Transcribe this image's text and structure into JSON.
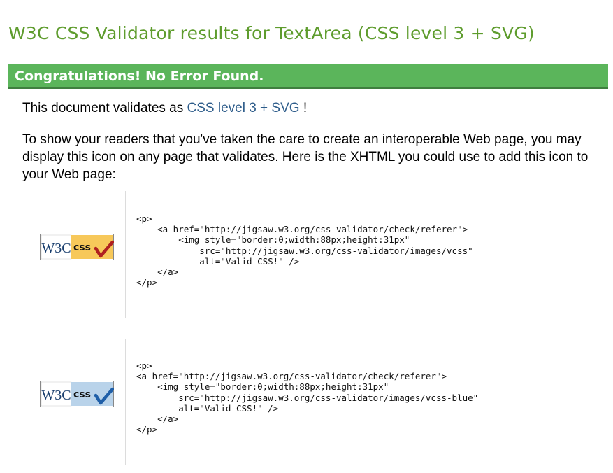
{
  "page": {
    "title": "W3C CSS Validator results for TextArea (CSS level 3 + SVG)"
  },
  "banner": {
    "text": "Congratulations! No Error Found.",
    "color": "#5bb55b"
  },
  "validates": {
    "prefix": "This document validates as ",
    "link_text": "CSS level 3 + SVG",
    "suffix": " !"
  },
  "info": {
    "text": "To show your readers that you've taken the care to create an interoperable Web page, you may display this icon on any page that validates. Here is the XHTML you could use to add this icon to your Web page:"
  },
  "examples": [
    {
      "badge": {
        "logo_text": "W3C",
        "css_text": "css",
        "style": "gold",
        "check_color": "#b02020",
        "panel_color": "#f7c85a"
      },
      "code": "<p>\n    <a href=\"http://jigsaw.w3.org/css-validator/check/referer\">\n        <img style=\"border:0;width:88px;height:31px\"\n            src=\"http://jigsaw.w3.org/css-validator/images/vcss\"\n            alt=\"Valid CSS!\" />\n    </a>\n</p>"
    },
    {
      "badge": {
        "logo_text": "W3C",
        "css_text": "css",
        "style": "blue",
        "check_color": "#1f5fa8",
        "panel_color": "#b9d3ea"
      },
      "code": "<p>\n<a href=\"http://jigsaw.w3.org/css-validator/check/referer\">\n    <img style=\"border:0;width:88px;height:31px\"\n        src=\"http://jigsaw.w3.org/css-validator/images/vcss-blue\"\n        alt=\"Valid CSS!\" />\n    </a>\n</p>"
    }
  ]
}
